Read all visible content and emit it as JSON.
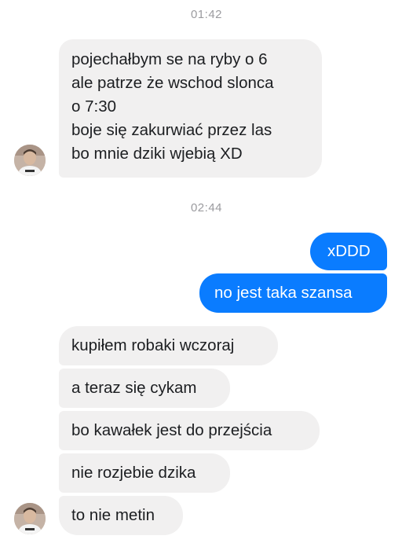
{
  "thread": {
    "time_1": "01:42",
    "time_2": "02:44",
    "msg_long": {
      "lines": [
        "pojechałbym se na ryby o 6",
        "ale patrze że wschod slonca",
        "o 7:30",
        "boje się zakurwiać przez las",
        "bo mnie dziki wjebią  XD"
      ]
    },
    "out_1": "xDDD",
    "out_2": "no jest taka szansa",
    "in_1": "kupiłem robaki wczoraj",
    "in_2": "a teraz się cykam",
    "in_3": "bo kawałek jest do przejścia",
    "in_4": "nie rozjebie dzika",
    "in_5": "to nie metin"
  },
  "colors": {
    "incoming_bubble": "#f1f0f0",
    "outgoing_bubble": "#0a7cff",
    "timestamp": "#9b9b9f"
  },
  "icons": {
    "contact_avatar": "contact-avatar-photo"
  }
}
